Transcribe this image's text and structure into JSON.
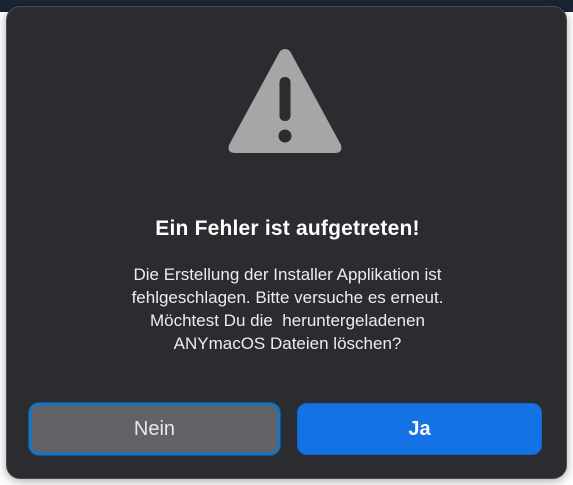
{
  "dialog": {
    "title": "Ein Fehler ist aufgetreten!",
    "message_lines": [
      "Die Erstellung der Installer Applikation ist",
      "fehlgeschlagen. Bitte versuche es erneut.",
      "Möchtest Du die  heruntergeladenen",
      "ANYmacOS Dateien löschen?"
    ],
    "icon": "warning-triangle-icon",
    "buttons": {
      "cancel_label": "Nein",
      "confirm_label": "Ja"
    }
  },
  "colors": {
    "dialog_background": "#2a2c30",
    "confirm_button": "#1572e4",
    "cancel_button": "#626366",
    "focus_ring": "#1f73b8",
    "warning_icon": "#a6a6a6"
  }
}
